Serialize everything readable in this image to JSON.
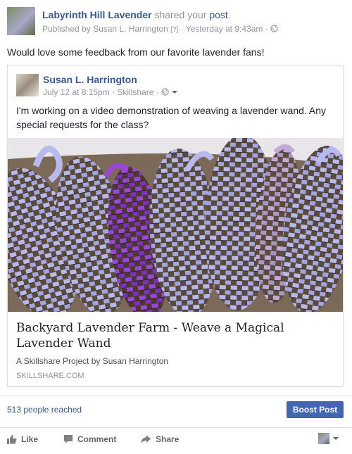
{
  "header": {
    "page_name": "Labyrinth Hill Lavender",
    "shared_text": "shared your",
    "post_word": "post",
    "published_prefix": "Published by",
    "author": "Susan L. Harrington",
    "help_marker": "[?]",
    "timestamp": "Yesterday at 9:43am",
    "separator": "·"
  },
  "caption": "Would love some feedback from our favorite lavender fans!",
  "shared_post": {
    "author": "Susan L. Harrington",
    "date": "July 12 at 8:15pm",
    "app": "Skillshare",
    "separator": "·",
    "text": "I'm working on a video demonstration of weaving a lavender wand. Any special requests for the class?",
    "link_title": "Backyard Lavender Farm - Weave a Magical Lavender Wand",
    "link_description": "A Skillshare Project by Susan Harrington",
    "link_domain": "SKILLSHARE.COM"
  },
  "footer": {
    "reach": "513 people reached",
    "boost_label": "Boost Post"
  },
  "actions": {
    "like": "Like",
    "comment": "Comment",
    "share": "Share"
  },
  "colors": {
    "link_blue": "#365899",
    "button_blue": "#4267b2",
    "muted": "#90949c",
    "lavender": "#a7a6e0",
    "purple": "#8b3ad1"
  },
  "icons": [
    "globe-icon",
    "caret-down-icon",
    "like-icon",
    "comment-icon",
    "share-icon"
  ]
}
